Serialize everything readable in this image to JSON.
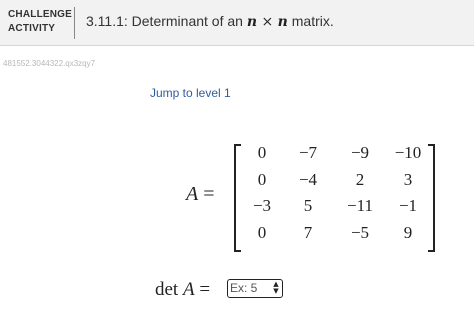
{
  "header": {
    "activity_type_line1": "CHALLENGE",
    "activity_type_line2": "ACTIVITY",
    "title_prefix": "3.11.1: Determinant of an ",
    "title_n1": "n",
    "title_times": " × ",
    "title_n2": "n",
    "title_suffix": " matrix."
  },
  "activity_id": "481552.3044322.qx3zqy7",
  "jump_link": "Jump to level 1",
  "equation": {
    "lhs_var": "A",
    "lhs_eq": " =",
    "matrix": [
      [
        "0",
        "−7",
        "−9",
        "−10"
      ],
      [
        "0",
        "−4",
        "2",
        "3"
      ],
      [
        "−3",
        "5",
        "−11",
        "−1"
      ],
      [
        "0",
        "7",
        "−5",
        "9"
      ]
    ]
  },
  "answer": {
    "label_det": "det ",
    "label_var": "A",
    "label_eq": " =",
    "placeholder": "Ex: 5",
    "spinner_up": "▲",
    "spinner_down": "▼"
  }
}
